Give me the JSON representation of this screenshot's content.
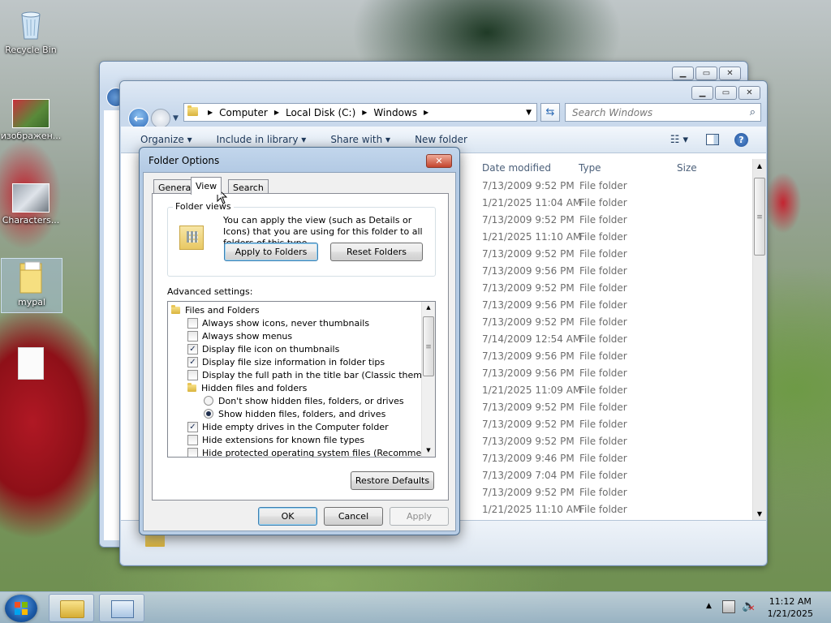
{
  "desktop": {
    "icons": [
      {
        "label": "Recycle Bin"
      },
      {
        "label": "изображен..."
      },
      {
        "label": "Characters..."
      },
      {
        "label": "mypal"
      },
      {
        "label": ""
      }
    ]
  },
  "explorer": {
    "address": {
      "segments": [
        "Computer",
        "Local Disk (C:)",
        "Windows"
      ]
    },
    "search_placeholder": "Search Windows",
    "commands": [
      "Organize ▾",
      "Include in library ▾",
      "Share with ▾",
      "New folder"
    ],
    "columns": {
      "date": "Date modified",
      "type": "Type",
      "size": "Size"
    },
    "rows": [
      {
        "date": "7/13/2009 9:52 PM",
        "type": "File folder"
      },
      {
        "date": "1/21/2025 11:04 AM",
        "type": "File folder"
      },
      {
        "date": "7/13/2009 9:52 PM",
        "type": "File folder"
      },
      {
        "date": "1/21/2025 11:10 AM",
        "type": "File folder"
      },
      {
        "date": "7/13/2009 9:52 PM",
        "type": "File folder"
      },
      {
        "date": "7/13/2009 9:56 PM",
        "type": "File folder"
      },
      {
        "date": "7/13/2009 9:52 PM",
        "type": "File folder"
      },
      {
        "date": "7/13/2009 9:56 PM",
        "type": "File folder"
      },
      {
        "date": "7/13/2009 9:52 PM",
        "type": "File folder"
      },
      {
        "date": "7/14/2009 12:54 AM",
        "type": "File folder"
      },
      {
        "date": "7/13/2009 9:56 PM",
        "type": "File folder"
      },
      {
        "date": "7/13/2009 9:56 PM",
        "type": "File folder"
      },
      {
        "date": "1/21/2025 11:09 AM",
        "type": "File folder"
      },
      {
        "date": "7/13/2009 9:52 PM",
        "type": "File folder"
      },
      {
        "date": "7/13/2009 9:52 PM",
        "type": "File folder"
      },
      {
        "date": "7/13/2009 9:52 PM",
        "type": "File folder"
      },
      {
        "date": "7/13/2009 9:46 PM",
        "type": "File folder"
      },
      {
        "date": "7/13/2009 7:04 PM",
        "type": "File folder"
      },
      {
        "date": "7/13/2009 9:52 PM",
        "type": "File folder"
      },
      {
        "date": "1/21/2025 11:10 AM",
        "type": "File folder"
      }
    ]
  },
  "dialog": {
    "title": "Folder Options",
    "close": "✕",
    "tabs": [
      "General",
      "View",
      "Search"
    ],
    "folder_views": {
      "label": "Folder views",
      "description": "You can apply the view (such as Details or Icons) that you are using for this folder to all folders of this type.",
      "apply_button": "Apply to Folders",
      "reset_button": "Reset Folders"
    },
    "advanced_label": "Advanced settings:",
    "items": [
      {
        "kind": "folder",
        "label": "Files and Folders",
        "indent": 0
      },
      {
        "kind": "check",
        "label": "Always show icons, never thumbnails",
        "checked": false,
        "indent": 1
      },
      {
        "kind": "check",
        "label": "Always show menus",
        "checked": false,
        "indent": 1
      },
      {
        "kind": "check",
        "label": "Display file icon on thumbnails",
        "checked": true,
        "indent": 1
      },
      {
        "kind": "check",
        "label": "Display file size information in folder tips",
        "checked": true,
        "indent": 1
      },
      {
        "kind": "check",
        "label": "Display the full path in the title bar (Classic theme only)",
        "checked": false,
        "indent": 1
      },
      {
        "kind": "folder",
        "label": "Hidden files and folders",
        "indent": 1
      },
      {
        "kind": "radio",
        "label": "Don't show hidden files, folders, or drives",
        "checked": false,
        "indent": 2
      },
      {
        "kind": "radio",
        "label": "Show hidden files, folders, and drives",
        "checked": true,
        "indent": 2
      },
      {
        "kind": "check",
        "label": "Hide empty drives in the Computer folder",
        "checked": true,
        "indent": 1
      },
      {
        "kind": "check",
        "label": "Hide extensions for known file types",
        "checked": false,
        "indent": 1
      },
      {
        "kind": "check",
        "label": "Hide protected operating system files (Recommended)",
        "checked": false,
        "indent": 1
      }
    ],
    "restore_button": "Restore Defaults",
    "ok_button": "OK",
    "cancel_button": "Cancel",
    "apply_button": "Apply"
  },
  "taskbar": {
    "time": "11:12 AM",
    "date": "1/21/2025"
  }
}
